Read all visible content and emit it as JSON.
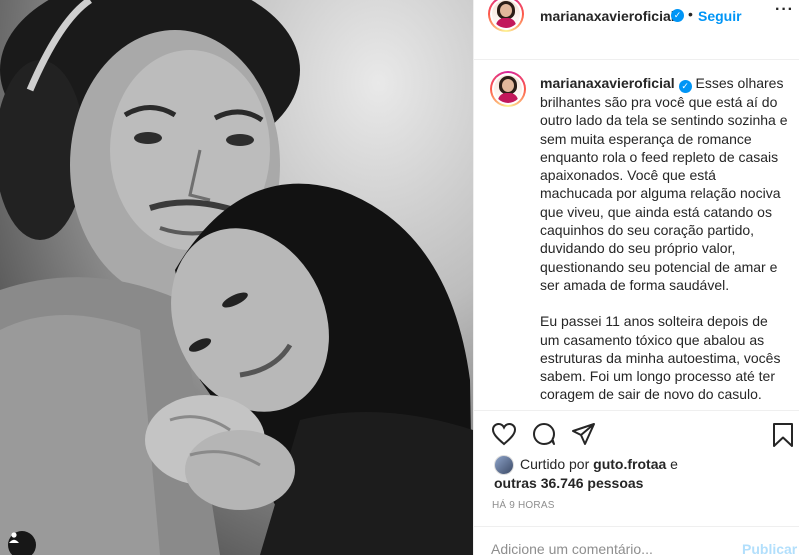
{
  "post": {
    "username": "marianaxavieroficial",
    "verified_glyph": "✓",
    "dot": "•",
    "follow_label": "Seguir",
    "more_icon": "more-options-icon",
    "more_label": "···"
  },
  "caption": {
    "username": "marianaxavieroficial",
    "paragraph1": "Esses olhares brilhantes são pra você que está aí do outro lado da tela se sentindo sozinha e sem muita esperança de romance enquanto rola o feed repleto de casais apaixonados. Você que está machucada por alguma relação nociva que viveu, que ainda está catando os caquinhos do seu coração partido, duvidando do seu próprio valor, questionando seu potencial de amar e ser amada de forma saudável.",
    "paragraph2": "Eu passei 11 anos solteira depois de um casamento tóxico que abalou as estruturas da minha autoestima, vocês sabem. Foi um longo processo até ter coragem de sair de novo do casulo."
  },
  "actions": {
    "icons": [
      "heart-icon",
      "comment-icon",
      "share-icon",
      "bookmark-icon"
    ]
  },
  "likes": {
    "prefix": "Curtido por",
    "liker": "guto.frotaa",
    "conjunction": "e",
    "others_prefix": "outras",
    "count": "36.746",
    "others_suffix": "pessoas"
  },
  "timestamp": "HÁ 9 HORAS",
  "comment_form": {
    "placeholder": "Adicione um comentário...",
    "publish_label": "Publicar"
  },
  "colors": {
    "accent": "#0095f6",
    "text": "#262626",
    "muted": "#8e8e8e",
    "border": "#efefef",
    "publish_disabled": "#b2dffc"
  }
}
